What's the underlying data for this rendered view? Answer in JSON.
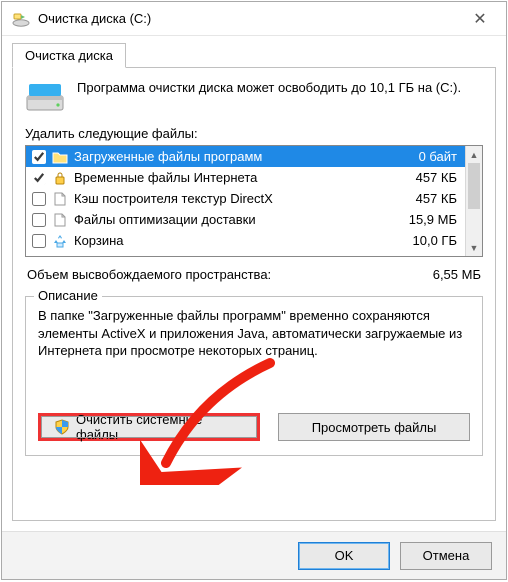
{
  "window": {
    "title": "Очистка диска  (C:)"
  },
  "tab": {
    "label": "Очистка диска"
  },
  "intro": "Программа очистки диска может освободить до 10,1 ГБ на (C:).",
  "delete_label": "Удалить следующие файлы:",
  "files": [
    {
      "label": "Загруженные файлы программ",
      "size": "0 байт",
      "checked": true,
      "selected": true,
      "icon": "folder"
    },
    {
      "label": "Временные файлы Интернета",
      "size": "457 КБ",
      "checked": true,
      "selected": false,
      "icon": "lock"
    },
    {
      "label": "Кэш построителя текстур DirectX",
      "size": "457 КБ",
      "checked": false,
      "selected": false,
      "icon": "file"
    },
    {
      "label": "Файлы оптимизации доставки",
      "size": "15,9 МБ",
      "checked": false,
      "selected": false,
      "icon": "file"
    },
    {
      "label": "Корзина",
      "size": "10,0 ГБ",
      "checked": false,
      "selected": false,
      "icon": "recycle"
    }
  ],
  "freespace": {
    "label": "Объем высвобождаемого пространства:",
    "value": "6,55 МБ"
  },
  "description": {
    "legend": "Описание",
    "text": "В папке \"Загруженные файлы программ\" временно сохраняются элементы ActiveX и приложения Java, автоматически загружаемые из Интернета при просмотре некоторых страниц."
  },
  "buttons": {
    "system": "Очистить системные файлы",
    "view": "Просмотреть файлы",
    "ok": "OK",
    "cancel": "Отмена"
  }
}
